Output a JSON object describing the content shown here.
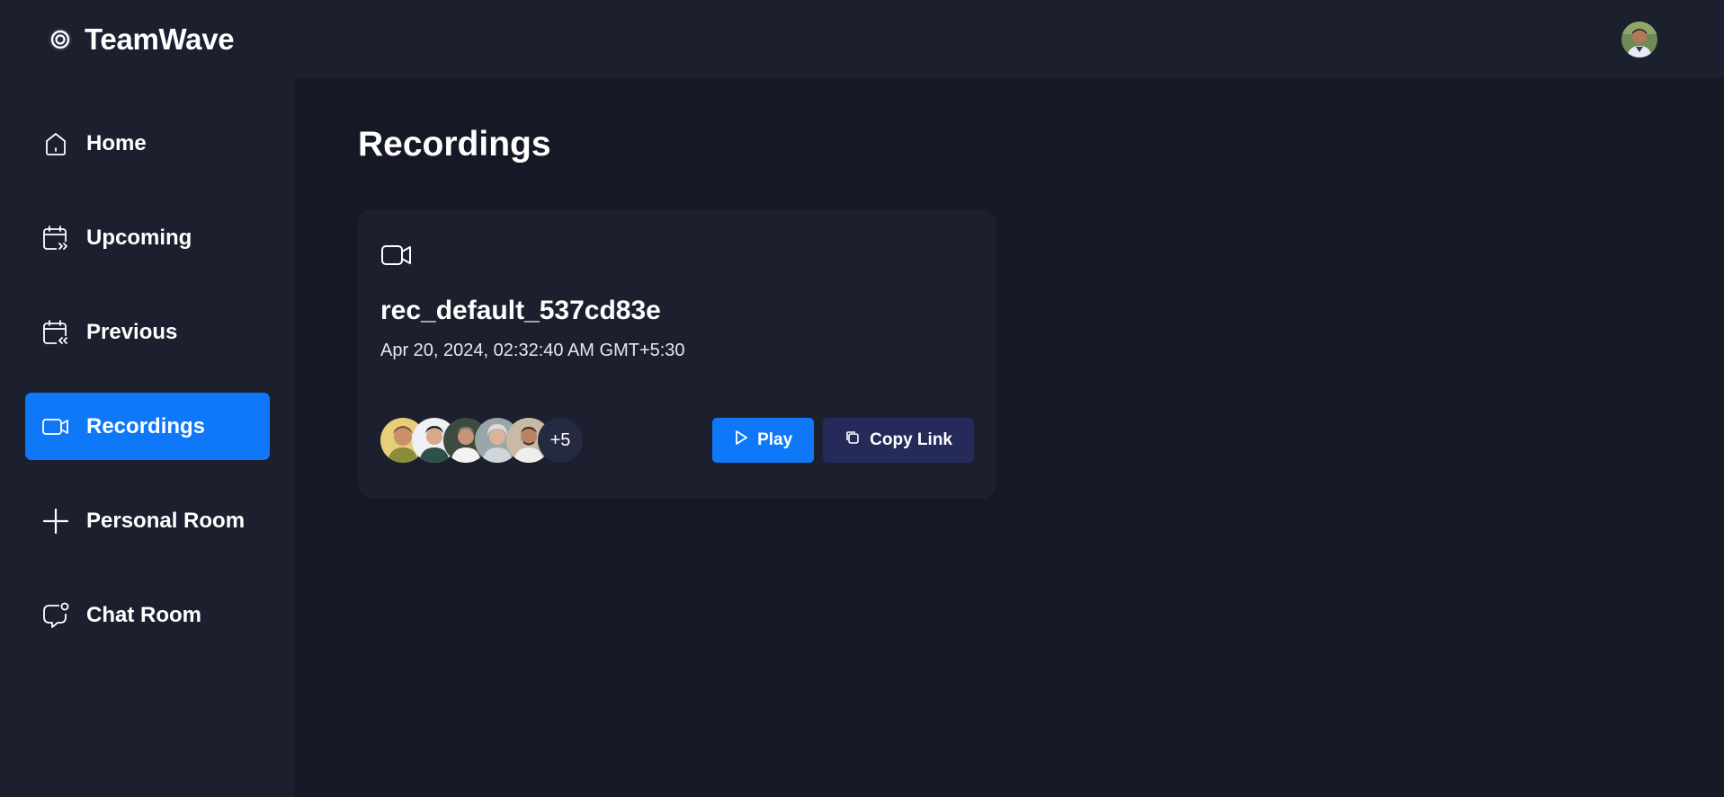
{
  "app": {
    "name": "TeamWave"
  },
  "sidebar": {
    "items": [
      {
        "label": "Home",
        "icon": "home-icon"
      },
      {
        "label": "Upcoming",
        "icon": "calendar-forward-icon"
      },
      {
        "label": "Previous",
        "icon": "calendar-back-icon"
      },
      {
        "label": "Recordings",
        "icon": "video-icon",
        "active": true
      },
      {
        "label": "Personal Room",
        "icon": "plus-icon"
      },
      {
        "label": "Chat Room",
        "icon": "chat-bubble-icon"
      }
    ]
  },
  "main": {
    "title": "Recordings",
    "recording": {
      "name": "rec_default_537cd83e",
      "date": "Apr 20, 2024, 02:32:40 AM GMT+5:30",
      "participants_more": "+5",
      "play_label": "Play",
      "copy_label": "Copy Link"
    }
  },
  "colors": {
    "accent": "#0e78f9",
    "panel": "#1c1f2e",
    "background": "#161925",
    "copy_button": "#252a5b"
  }
}
